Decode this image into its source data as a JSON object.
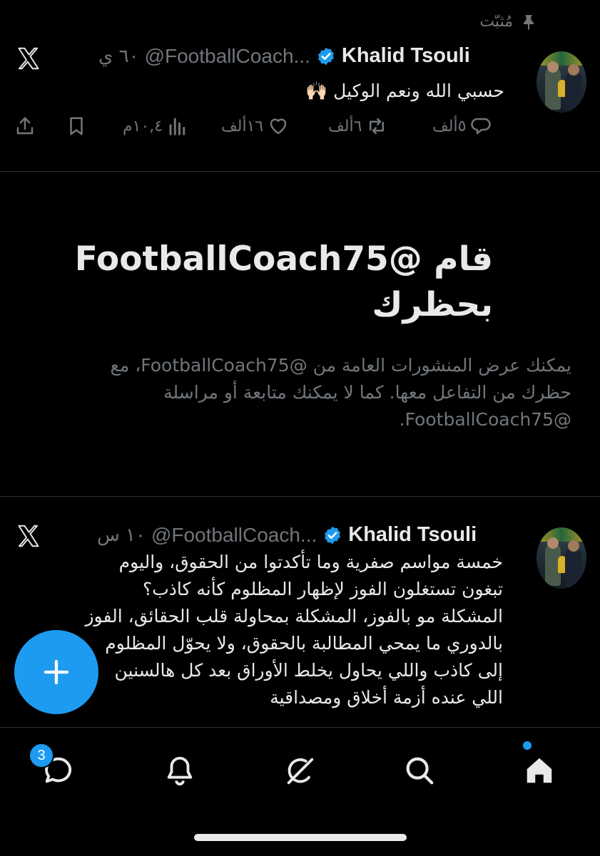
{
  "colors": {
    "accent": "#1d9bf0",
    "text": "#e7e9ea",
    "muted": "#71767b",
    "background": "#000000",
    "divider": "#2f3336"
  },
  "pinned_tweet": {
    "pinned_label": "مُثبّت",
    "author_name": "Khalid Tsouli",
    "handle": "@FootballCoach...",
    "time": "٦٠ ي",
    "text": "حسبي الله ونعم الوكيل 🙌🏻",
    "replies": "٥ألف",
    "reposts": "٦ألف",
    "likes": "١٦ألف",
    "views": "١٠,٤م",
    "icons": {
      "pin": "pin-icon",
      "verified": "verified-badge-icon",
      "platform": "x-logo-icon",
      "reply": "reply-icon",
      "repost": "repost-icon",
      "like": "heart-icon",
      "views": "views-icon",
      "bookmark": "bookmark-icon",
      "share": "share-icon"
    }
  },
  "blocked_notice": {
    "title_line1": "قام @FootballCoach75",
    "title_line2": "بحظرك",
    "desc_line1": "يمكنك عرض المنشورات العامة من @FootballCoach75، مع",
    "desc_line2": "حظرك من التفاعل معها. كما لا يمكنك متابعة أو مراسلة",
    "desc_line3": "@FootballCoach75."
  },
  "tweet2": {
    "author_name": "Khalid Tsouli",
    "handle": "@FootballCoach...",
    "time": "١٠ س",
    "lines": [
      "خمسة مواسم صفرية وما تأكدتوا من الحقوق، واليوم",
      "تبغون تستغلون الفوز لإظهار المظلوم كأنه كاذب؟",
      "المشكلة مو بالفوز، المشكلة بمحاولة قلب الحقائق، الفوز",
      "بالدوري ما يمحي المطالبة بالحقوق، ولا يحوّل المظلوم",
      "إلى كاذب واللي يحاول يخلط الأوراق بعد كل هالسنين",
      "اللي عنده أزمة أخلاق ومصداقية"
    ]
  },
  "fab": {
    "icon": "plus-icon"
  },
  "tabbar": {
    "messages_badge": "3",
    "tabs": [
      "messages-icon",
      "notifications-bell-icon",
      "grok-icon",
      "search-icon",
      "home-icon"
    ]
  }
}
